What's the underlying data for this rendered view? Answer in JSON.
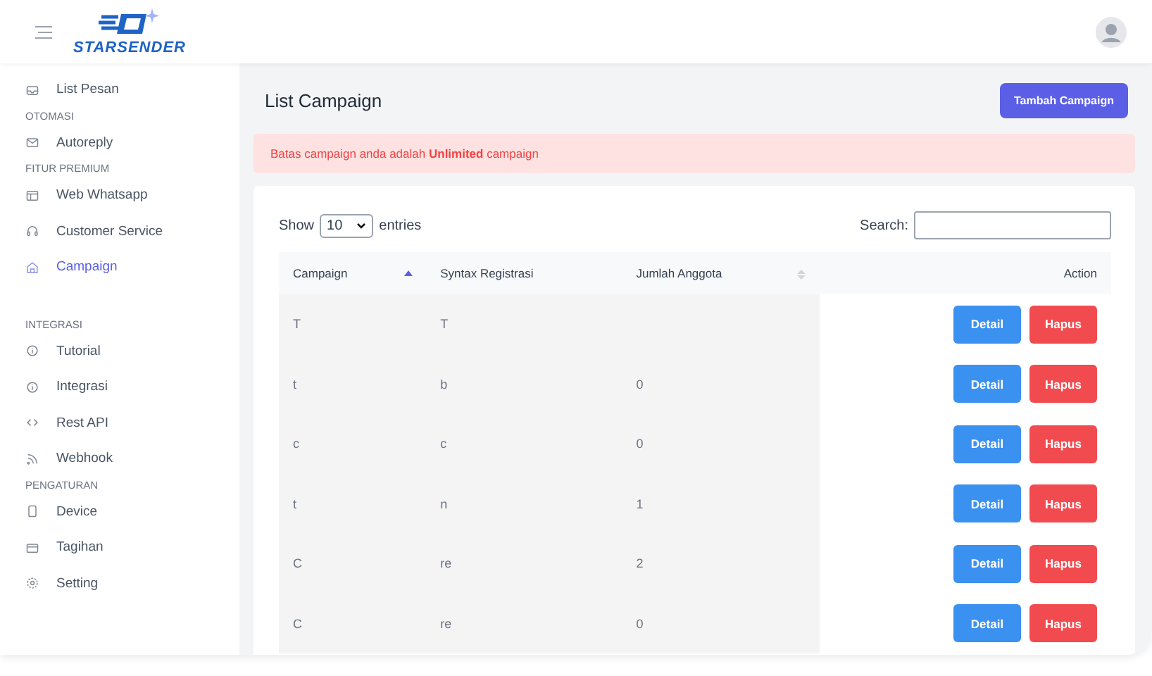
{
  "brand": {
    "name": "STARSENDER"
  },
  "sidebar": {
    "items": [
      {
        "kind": "item",
        "label": "List Pesan",
        "selected": false
      },
      {
        "kind": "heading",
        "label": "OTOMASI"
      },
      {
        "kind": "item",
        "label": "Autoreply",
        "selected": false
      },
      {
        "kind": "heading",
        "label": "FITUR PREMIUM"
      },
      {
        "kind": "item",
        "label": "Web Whatsapp",
        "selected": false
      },
      {
        "kind": "item",
        "label": "Customer Service",
        "selected": false
      },
      {
        "kind": "item",
        "label": "Campaign",
        "selected": true
      },
      {
        "kind": "spacer"
      },
      {
        "kind": "heading",
        "label": "INTEGRASI"
      },
      {
        "kind": "item",
        "label": "Tutorial",
        "selected": false
      },
      {
        "kind": "item",
        "label": "Integrasi",
        "selected": false
      },
      {
        "kind": "item",
        "label": "Rest API",
        "selected": false
      },
      {
        "kind": "item",
        "label": "Webhook",
        "selected": false
      },
      {
        "kind": "heading",
        "label": "PENGATURAN"
      },
      {
        "kind": "item",
        "label": "Device",
        "selected": false
      },
      {
        "kind": "item",
        "label": "Tagihan",
        "selected": false
      },
      {
        "kind": "item",
        "label": "Setting",
        "selected": false
      }
    ]
  },
  "page": {
    "title": "List Campaign",
    "add_button": "Tambah Campaign",
    "alert": "Batas campaign anda adalah **Unlimited** campaign"
  },
  "table": {
    "show_label": "Show",
    "page_size": "10",
    "entries_label": "entries",
    "search_label": "Search:",
    "columns": [
      {
        "label": "Campaign"
      },
      {
        "label": "Syntax Registrasi"
      },
      {
        "label": "Jumlah Anggota"
      },
      {
        "label": "Action"
      }
    ],
    "rows": [
      {
        "campaign": "T",
        "syntax": "T",
        "detail": "Detail",
        "delete": "Hapus"
      },
      {
        "campaign": "t",
        "syntax": "b",
        "members": "0",
        "detail": "Detail",
        "delete": "Hapus"
      },
      {
        "campaign": "c",
        "syntax": "c",
        "members": "0",
        "detail": "Detail",
        "delete": "Hapus"
      },
      {
        "campaign": "t",
        "syntax": "n",
        "members": "1",
        "detail": "Detail",
        "delete": "Hapus"
      },
      {
        "campaign": "C",
        "syntax": "re",
        "members": "2",
        "detail": "Detail",
        "delete": "Hapus"
      },
      {
        "campaign": "C",
        "syntax": "re",
        "members": "0",
        "detail": "Detail",
        "delete": "Hapus"
      }
    ]
  }
}
